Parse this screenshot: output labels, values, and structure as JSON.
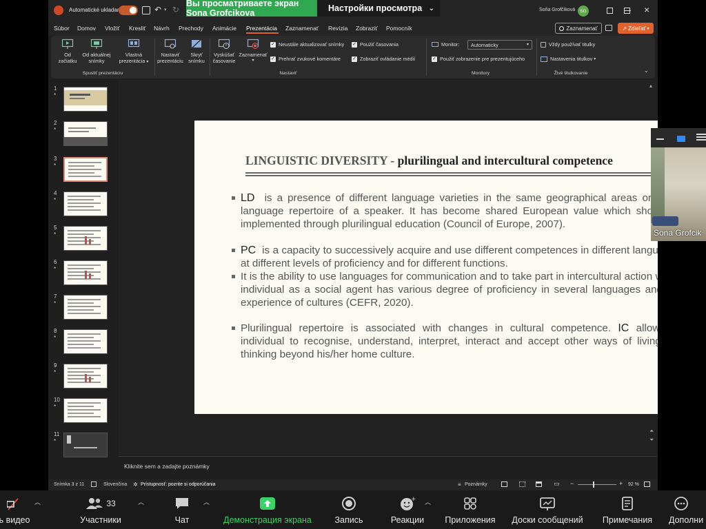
{
  "titlebar": {
    "autosave_label": "Automatické ukladanie",
    "user_name": "Soňa Grofčíková",
    "user_initials": "SG"
  },
  "share_banner": {
    "status": "Вы просматриваете экран Sona Grofcikova",
    "settings": "Настройки просмотра"
  },
  "menu": {
    "items": [
      "Súbor",
      "Domov",
      "Vložiť",
      "Kresliť",
      "Návrh",
      "Prechody",
      "Animácie",
      "Prezentácia",
      "Zaznamenať",
      "Revízia",
      "Zobraziť",
      "Pomocník"
    ],
    "record_button": "Zaznamenať",
    "share_button": "Zdieľať"
  },
  "ribbon": {
    "from_start": [
      "Od",
      "začiatku"
    ],
    "from_current": [
      "Od aktuálnej",
      "snímky"
    ],
    "custom": [
      "Vlastná",
      "prezentácia"
    ],
    "group_start": "Spustiť prezentáciu",
    "setup": [
      "Nastaviť",
      "prezentáciu"
    ],
    "hide": [
      "Skryť",
      "snímku"
    ],
    "rehearse": [
      "Vyskúšať",
      "časovanie"
    ],
    "record": [
      "Zaznamenať"
    ],
    "chk_update": "Neustále aktualizovať snímky",
    "chk_narration": "Prehrať zvukové komentáre",
    "chk_timings": "Použiť časovania",
    "chk_media": "Zobraziť ovládanie médií",
    "group_setup": "Nastaviť",
    "monitor_label": "Monitor:",
    "monitor_value": "Automaticky",
    "presenter_view": "Použiť zobrazenie pre prezentujúceho",
    "group_monitors": "Monitory",
    "always_subtitles": "Vždy používať titulky",
    "subtitle_settings": "Nastavenia titulkov",
    "group_captions": "Živé titulkovanie"
  },
  "thumbnails": [
    "1",
    "2",
    "3",
    "4",
    "5",
    "6",
    "7",
    "8",
    "9",
    "10",
    "11"
  ],
  "thumbnail_marker": "*",
  "active_slide": 3,
  "slide": {
    "title_part1": "LINGUISTIC DIVERSITY",
    "title_sep": " - ",
    "title_part2": "plurilingual and intercultural competence",
    "b1_term": "LD",
    "b1_text": "is a presence of different language varieties in the same geographical areas or in the language repertoire of a speaker. It has become shared European value which should be implemented through plurilingual education (Council of Europe, 2007).",
    "b2_term": "PC",
    "b2_text": "is a capacity to successively acquire and use different competences in different languages, at different levels of proficiency and for different functions.",
    "b3_text": "It is the ability to use languages for communication and to take part in intercultural action where individual as a social agent has various degree of proficiency in several languages and has experience of cultures (CEFR, 2020).",
    "b4_text_a": "Plurilingual repertoire is associated with changes in cultural competence.",
    "b4_term": "IC",
    "b4_text_b": "allows an individual to recognise, understand, interpret, interact and accept other ways of living and thinking beyond his/her home culture."
  },
  "notes_placeholder": "Kliknite sem a zadajte poznámky",
  "status": {
    "slide_counter": "Snímka 3 z 11",
    "language": "Slovenčina",
    "accessibility": "Prístupnosť: pozrite si odporúčania",
    "notes": "Poznámky",
    "zoom": "92 %"
  },
  "video": {
    "participant": "Sona Grofcik"
  },
  "zoom_toolbar": {
    "video": "ь видео",
    "participants": "Участники",
    "participants_count": "33",
    "chat": "Чат",
    "share": "Демонстрация экрана",
    "record": "Запись",
    "reactions": "Реакции",
    "apps": "Приложения",
    "whiteboards": "Доски сообщений",
    "notes": "Примечания",
    "more": "Дополни"
  },
  "colors": {
    "share_green": "#2fa84f",
    "accent_orange": "#e0622d",
    "slide_bg": "#fbfaf3"
  }
}
